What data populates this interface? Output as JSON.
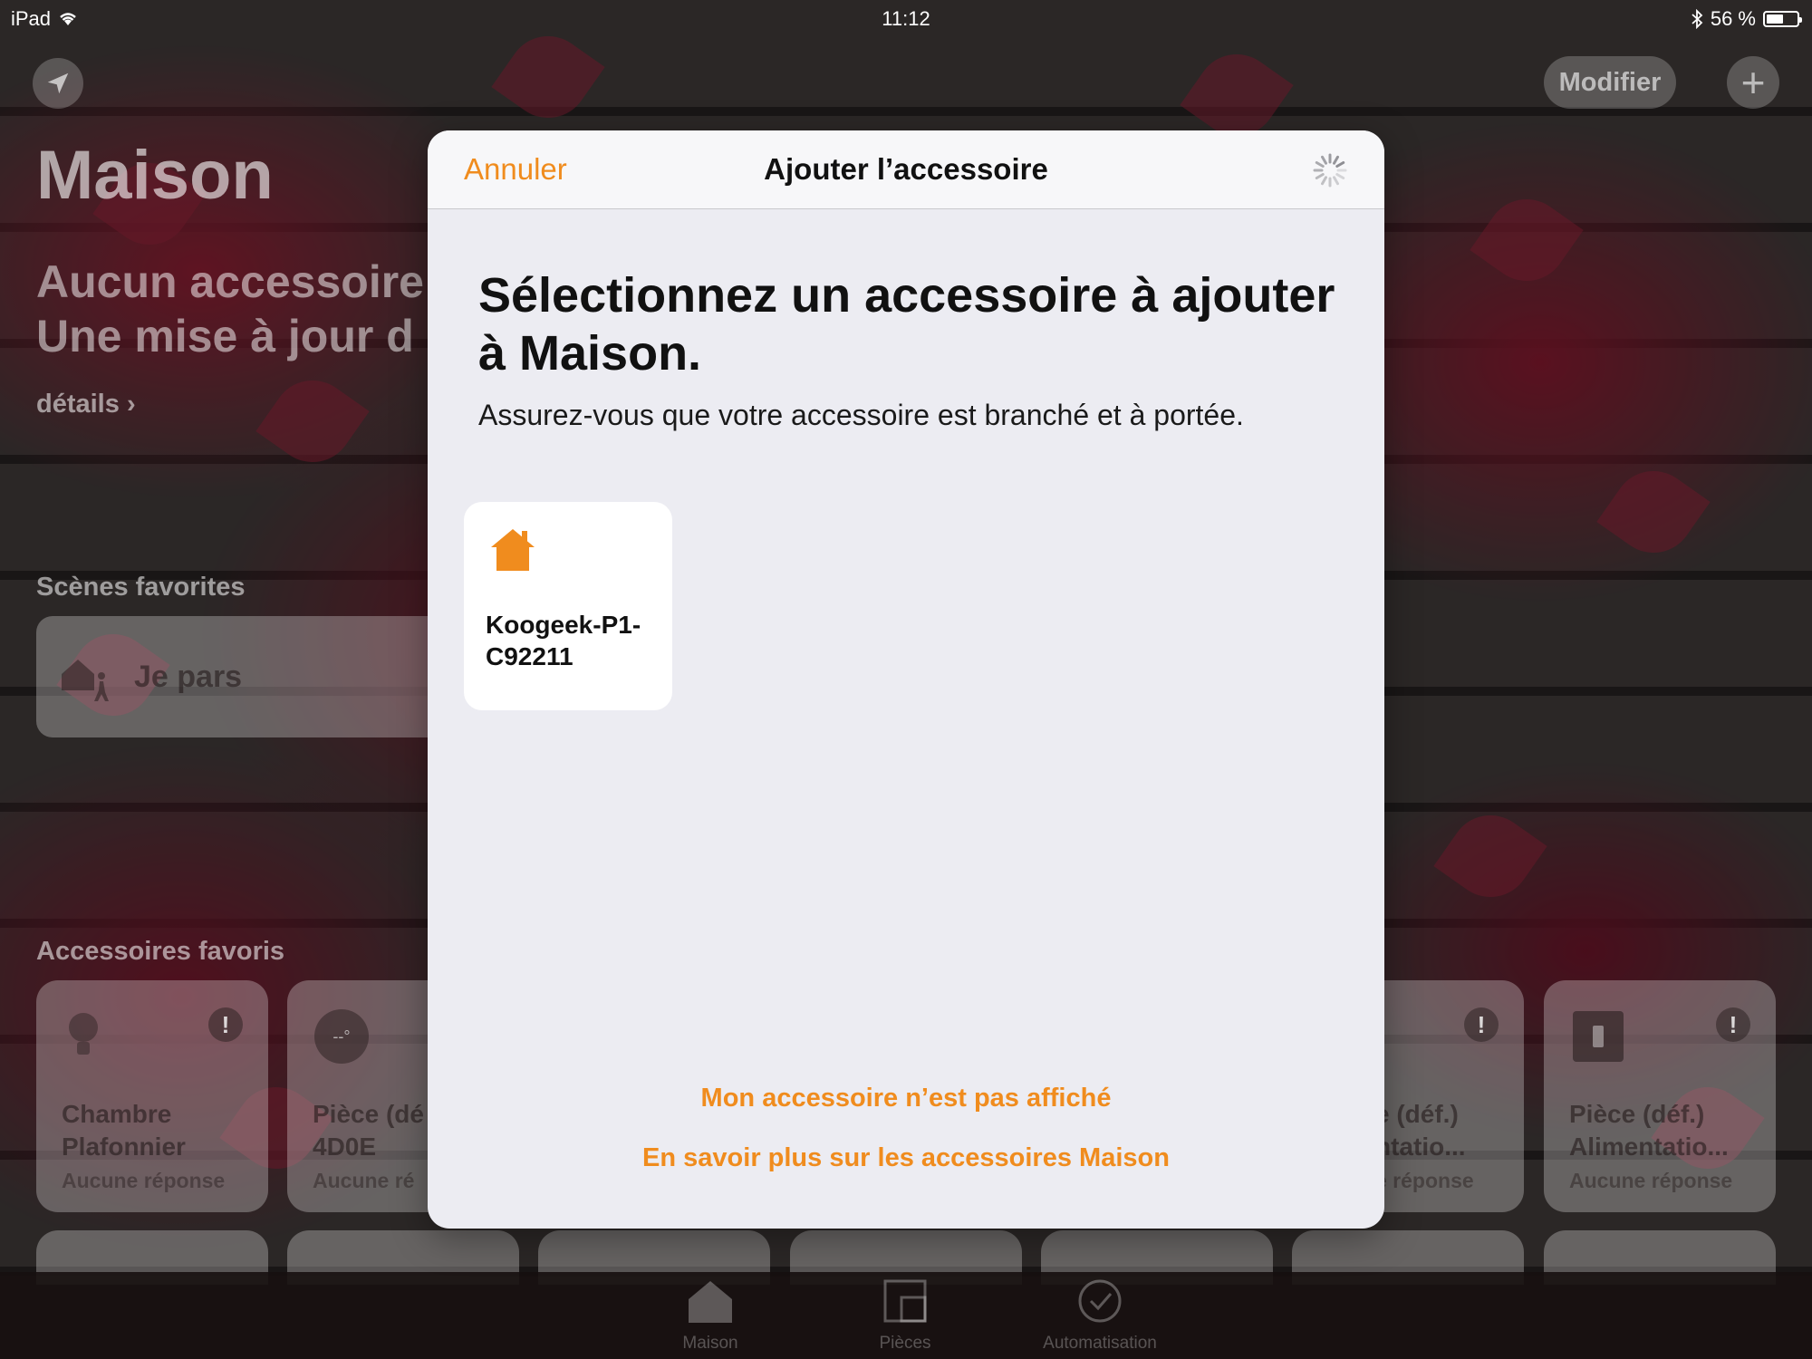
{
  "status_bar": {
    "device": "iPad",
    "time": "11:12",
    "battery_text": "56 %",
    "battery_level": 0.56
  },
  "home": {
    "title": "Maison",
    "status_line1": "Aucun accessoire",
    "status_line2": "Une mise à jour d",
    "details_link": "détails",
    "modify_label": "Modifier",
    "add_label": "+",
    "scenes_title": "Scènes favorites",
    "scene": {
      "label": "Je pars",
      "icon": "home-leave-icon"
    },
    "accessories_title": "Accessoires favoris",
    "accessories": [
      {
        "line1": "Chambre",
        "line2": "Plafonnier",
        "state": "Aucune réponse",
        "icon": "lightbulb-icon"
      },
      {
        "line1": "Pièce (dé",
        "line2": "4D0E",
        "state": "Aucune ré",
        "icon": "thermometer-icon"
      },
      {
        "line1": "e (déf.)",
        "line2": "ntatio...",
        "state": "e réponse",
        "icon": ""
      },
      {
        "line1": "Pièce (déf.)",
        "line2": "Alimentatio...",
        "state": "Aucune réponse",
        "icon": "outlet-icon"
      }
    ]
  },
  "tabbar": {
    "tabs": [
      {
        "label": "Maison",
        "icon": "home-tab-icon"
      },
      {
        "label": "Pièces",
        "icon": "rooms-tab-icon"
      },
      {
        "label": "Automatisation",
        "icon": "automation-tab-icon"
      }
    ]
  },
  "modal": {
    "cancel_label": "Annuler",
    "title": "Ajouter l’accessoire",
    "heading": "Sélectionnez un accessoire à ajouter à Maison.",
    "subtext": "Assurez-vous que votre accessoire est branché et à portée.",
    "accessory": {
      "name": "Koogeek-P1-C92211",
      "icon": "home-icon"
    },
    "link_not_shown": "Mon accessoire n’est pas affiché",
    "link_learn_more": "En savoir plus sur les accessoires Maison",
    "accent_color": "#F08C1E"
  }
}
